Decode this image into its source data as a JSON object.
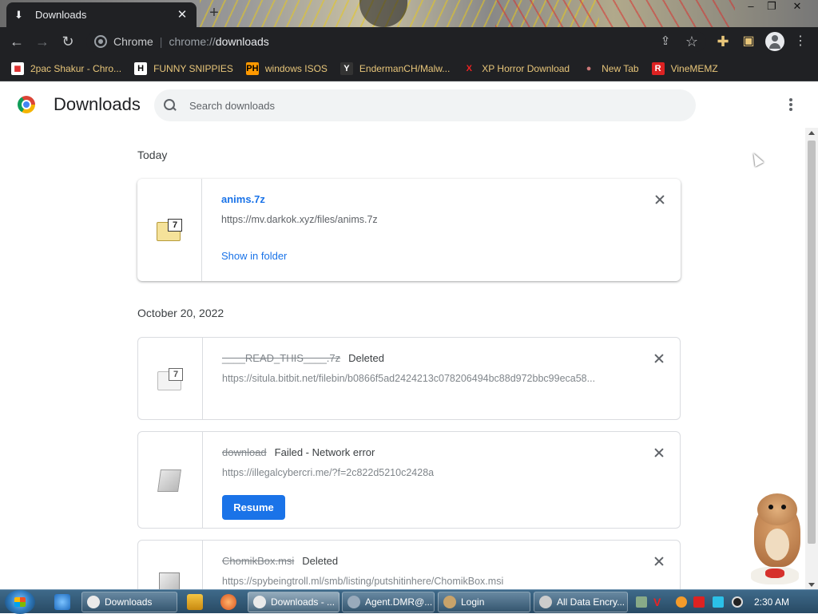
{
  "tab": {
    "title": "Downloads",
    "close_glyph": "✕",
    "new_tab_glyph": "+"
  },
  "window_controls": {
    "minimize": "–",
    "restore": "❐",
    "close": "✕"
  },
  "toolbar": {
    "scheme_label": "Chrome",
    "url_prefix": "chrome://",
    "url_host": "downloads",
    "icons": [
      "back-icon",
      "forward-icon",
      "reload-icon",
      "share-icon",
      "star-icon",
      "extensions-icon",
      "sidepanel-icon",
      "profile-icon",
      "menu-icon"
    ]
  },
  "bookmarks": [
    {
      "label": "2pac Shakur - Chro...",
      "fav": "◼",
      "fav_color": "#d33",
      "fav_bg": "#fff"
    },
    {
      "label": "FUNNY SNIPPIES",
      "fav": "H",
      "fav_color": "#000",
      "fav_bg": "#fff"
    },
    {
      "label": "windows ISOS",
      "fav": "PH",
      "fav_color": "#000",
      "fav_bg": "#f90"
    },
    {
      "label": "EndermanCH/Malw...",
      "fav": "Y",
      "fav_color": "#fff",
      "fav_bg": "#333"
    },
    {
      "label": "XP Horror Download",
      "fav": "X",
      "fav_color": "#e22",
      "fav_bg": "transparent"
    },
    {
      "label": "New Tab",
      "fav": "●",
      "fav_color": "#c77",
      "fav_bg": "transparent"
    },
    {
      "label": "VineMEMZ",
      "fav": "R",
      "fav_color": "#fff",
      "fav_bg": "#d22"
    }
  ],
  "page": {
    "title": "Downloads",
    "search_placeholder": "Search downloads"
  },
  "sections": [
    {
      "date": "Today",
      "items": [
        {
          "filename": "anims.7z",
          "status": "",
          "url": "https://mv.darkok.xyz/files/anims.7z",
          "action": "Show in folder",
          "state": "complete",
          "icon": "7z-archive-icon"
        }
      ]
    },
    {
      "date": "October 20, 2022",
      "items": [
        {
          "filename": "____READ_THIS____.7z",
          "status": "Deleted",
          "url": "https://situla.bitbit.net/filebin/b0866f5ad2424213c078206494bc88d972bbc99eca58...",
          "state": "deleted",
          "icon": "7z-archive-icon"
        },
        {
          "filename": "download",
          "status": "Failed - Network error",
          "url": "https://illegalcybercri.me/?f=2c822d5210c2428a",
          "action": "Resume",
          "state": "failed",
          "icon": "generic-file-icon"
        },
        {
          "filename": "ChomikBox.msi",
          "status": "Deleted",
          "url": "https://spybeingtroll.ml/smb/listing/putshitinhere/ChomikBox.msi",
          "state": "deleted",
          "icon": "msi-installer-icon"
        }
      ]
    }
  ],
  "taskbar": {
    "buttons": [
      {
        "label": "Downloads",
        "active": false
      },
      {
        "label": "Downloads - ...",
        "active": true
      },
      {
        "label": "Agent.DMR@...",
        "active": false
      },
      {
        "label": "Login",
        "active": false
      },
      {
        "label": "All Data Encry...",
        "active": false
      }
    ],
    "clock": "2:30 AM"
  }
}
